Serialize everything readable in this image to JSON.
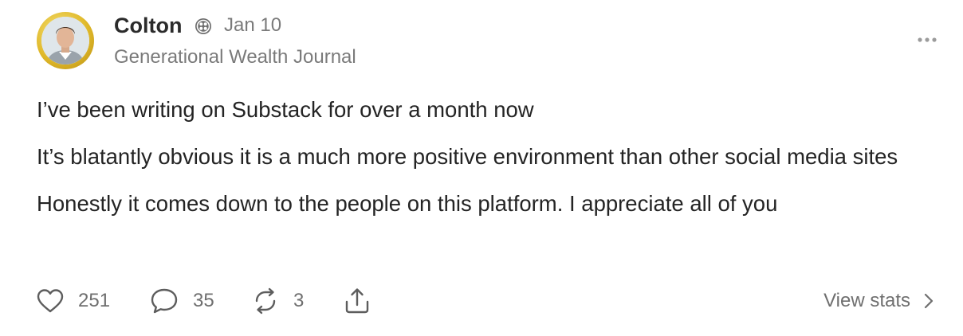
{
  "post": {
    "author": {
      "name": "Colton",
      "date": "Jan 10",
      "publication": "Generational Wealth Journal",
      "avatar_ring_color": "#e0b92a"
    },
    "body": [
      "I’ve been writing on Substack for over a month now",
      "It’s blatantly obvious it is a much more positive environment than other social media sites",
      "Honestly it comes down to the people on this platform. I appreciate all of you"
    ],
    "actions": {
      "like": {
        "icon": "heart-icon",
        "count": "251"
      },
      "comment": {
        "icon": "comment-icon",
        "count": "35"
      },
      "restack": {
        "icon": "restack-icon",
        "count": "3"
      },
      "share": {
        "icon": "share-icon"
      },
      "view_stats": {
        "label": "View stats",
        "icon": "chevron-right-icon"
      }
    }
  }
}
